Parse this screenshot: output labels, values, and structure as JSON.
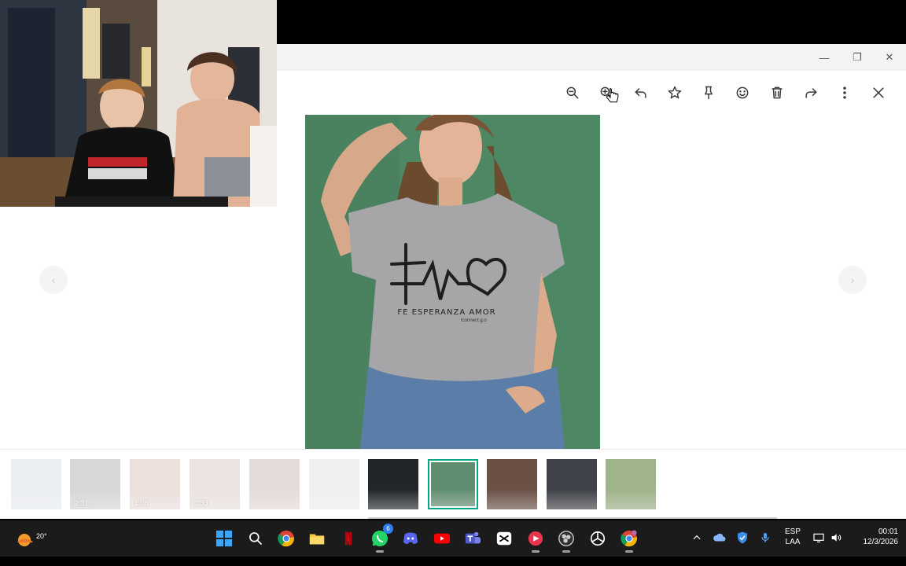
{
  "window": {
    "minimize_glyph": "—",
    "maximize_glyph": "❐",
    "close_glyph": "✕"
  },
  "viewer": {
    "toolbar": [
      {
        "name": "zoom-out",
        "icon": "zoom-out-icon"
      },
      {
        "name": "zoom-in",
        "icon": "zoom-in-icon"
      },
      {
        "name": "reply",
        "icon": "reply-icon"
      },
      {
        "name": "star",
        "icon": "star-icon"
      },
      {
        "name": "pin",
        "icon": "pin-icon"
      },
      {
        "name": "react",
        "icon": "emoji-icon"
      },
      {
        "name": "delete",
        "icon": "trash-icon"
      },
      {
        "name": "forward",
        "icon": "forward-icon"
      },
      {
        "name": "more",
        "icon": "kebab-menu-icon"
      },
      {
        "name": "close",
        "icon": "close-icon"
      }
    ],
    "photo": {
      "shirt_print_text": "FE ESPERANZA AMOR",
      "shirt_small_text": "tconnect.g.o"
    },
    "prev_glyph": "‹",
    "next_glyph": "›",
    "thumbnails": [
      {
        "kind": "image",
        "state": "faded",
        "color": "#c9d3dc"
      },
      {
        "kind": "video",
        "state": "faded",
        "duration": "2:31",
        "color": "#8f8f8f"
      },
      {
        "kind": "video",
        "state": "faded",
        "duration": "1:08",
        "color": "#c7a79a"
      },
      {
        "kind": "video",
        "state": "faded",
        "duration": "0:33",
        "color": "#c7b0a4"
      },
      {
        "kind": "image",
        "state": "faded",
        "color": "#b79b95"
      },
      {
        "kind": "image",
        "state": "faded",
        "color": "#cfd9d4"
      },
      {
        "kind": "image",
        "state": "normal",
        "color": "#22262b"
      },
      {
        "kind": "image",
        "state": "selected",
        "color": "#5e8d6f"
      },
      {
        "kind": "image",
        "state": "normal",
        "color": "#6b5046"
      },
      {
        "kind": "image",
        "state": "normal",
        "color": "#3f4248"
      },
      {
        "kind": "image",
        "state": "normal",
        "color": "#9fb48a"
      }
    ],
    "accent_color": "#00a884"
  },
  "taskbar": {
    "weather_temp": "20°",
    "apps": [
      "windows-start",
      "search",
      "chrome",
      "file-explorer",
      "netflix",
      "whatsapp",
      "discord",
      "youtube",
      "teams",
      "capcut",
      "app-red",
      "obs",
      "chatgpt",
      "chrome-profile"
    ],
    "whatsapp_badge": "6",
    "language_line1": "ESP",
    "language_line2": "LAA",
    "time": "00:01",
    "date": "12/3/2026"
  }
}
